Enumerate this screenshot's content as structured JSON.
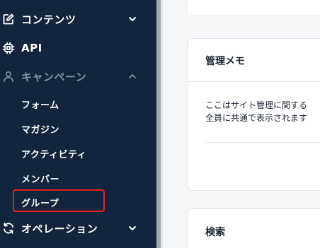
{
  "sidebar": {
    "items": [
      {
        "label": "コンテンツ",
        "icon": "edit-icon"
      },
      {
        "label": "API",
        "icon": "chip-icon"
      },
      {
        "label": "キャンペーン",
        "icon": "user-icon"
      },
      {
        "label": "オペレーション",
        "icon": "sync-icon"
      }
    ],
    "campaign_subitems": [
      "フォーム",
      "マガジン",
      "アクティビティ",
      "メンバー",
      "グループ"
    ]
  },
  "main": {
    "memo_card": {
      "title": "管理メモ",
      "line1": "ここはサイト管理に関する",
      "line2": "全員に共通で表示されます"
    },
    "search_card": {
      "title": "検索"
    }
  },
  "colors": {
    "sidebar_bg": "#13253e",
    "highlight": "#e02020",
    "page_bg": "#f5f6f8"
  }
}
